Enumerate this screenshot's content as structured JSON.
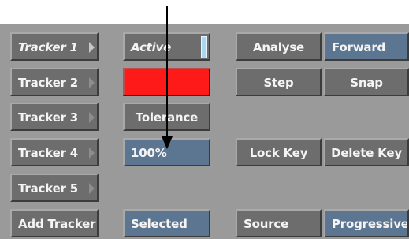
{
  "trackers": {
    "items": [
      {
        "label": "Tracker 1"
      },
      {
        "label": "Tracker 2"
      },
      {
        "label": "Tracker 3"
      },
      {
        "label": "Tracker 4"
      },
      {
        "label": "Tracker 5"
      }
    ],
    "add_label": "Add Tracker"
  },
  "settings": {
    "active_label": "Active",
    "tolerance_label": "Tolerance",
    "tolerance_value": "100%",
    "selected_label": "Selected",
    "swatch_color": "#ff1a1a"
  },
  "actions": {
    "analyse": "Analyse",
    "forward": "Forward",
    "step": "Step",
    "snap": "Snap",
    "lock_key": "Lock Key",
    "delete_key": "Delete Key",
    "source": "Source",
    "progressive": "Progressive"
  },
  "colors": {
    "button_gray": "#6d6d6d",
    "button_blue": "#5c7591",
    "panel_bg": "#9a9a9a",
    "active_indicator": "#a8d8f2"
  }
}
